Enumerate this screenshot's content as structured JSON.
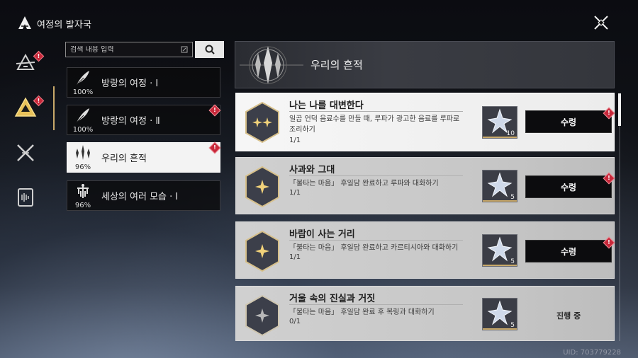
{
  "header": {
    "title": "여정의 발자국"
  },
  "search": {
    "placeholder": "검색 내용 입력"
  },
  "sidebar": {
    "categories": [
      {
        "label": "방랑의 여정 · Ⅰ",
        "progress": "100%"
      },
      {
        "label": "방랑의 여정 · Ⅱ",
        "progress": "100%"
      },
      {
        "label": "우리의 흔적",
        "progress": "96%"
      },
      {
        "label": "세상의 여러 모습 · Ⅰ",
        "progress": "96%"
      }
    ]
  },
  "section": {
    "title": "우리의 흔적"
  },
  "quests": [
    {
      "title": "나는 나를 대변한다",
      "desc": "일곱 언덕 음료수를 만들 때, 루파가 광고한 음료를 루파로 조리하기",
      "progress": "1/1",
      "reward_count": "10",
      "action": "수령"
    },
    {
      "title": "사과와 그대",
      "desc": "「불타는 마음」 후일담 완료하고 루파와 대화하기",
      "progress": "1/1",
      "reward_count": "5",
      "action": "수령"
    },
    {
      "title": "바람이 사는 거리",
      "desc": "「불타는 마음」 후일담 완료하고 카르티시아와 대화하기",
      "progress": "1/1",
      "reward_count": "5",
      "action": "수령"
    },
    {
      "title": "거울 속의 진실과 거짓",
      "desc": "「불타는 마음」 후일담 완료 후 복링과 대화하기",
      "progress": "0/1",
      "reward_count": "5",
      "action": "진행 중"
    }
  ],
  "badge_symbol": "!",
  "uid": "UID: 703779228",
  "colors": {
    "accent": "#c9a96a",
    "badge": "#c8283a"
  }
}
